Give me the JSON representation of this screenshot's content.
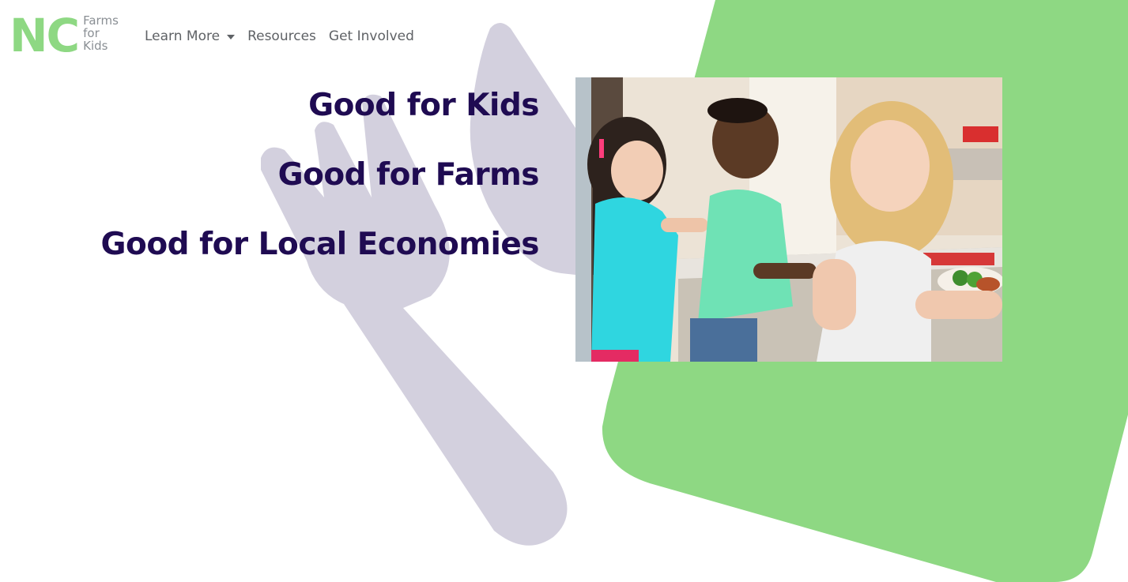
{
  "brand": {
    "nc": "NC",
    "words": [
      "Farms",
      "for",
      "Kids"
    ],
    "green": "#8ed883"
  },
  "nav": {
    "items": [
      {
        "label": "Learn More",
        "dropdown": true
      },
      {
        "label": "Resources",
        "dropdown": false
      },
      {
        "label": "Get Involved",
        "dropdown": false
      }
    ]
  },
  "hero": {
    "taglines": [
      "Good for Kids",
      "Good for Farms",
      "Good for Local Economies"
    ],
    "tagline_color": "#1f0b52"
  },
  "decor": {
    "utensil_color": "#d3d0de",
    "panel_color": "#8ed883",
    "icons": [
      "fork-icon",
      "knife-icon"
    ]
  }
}
